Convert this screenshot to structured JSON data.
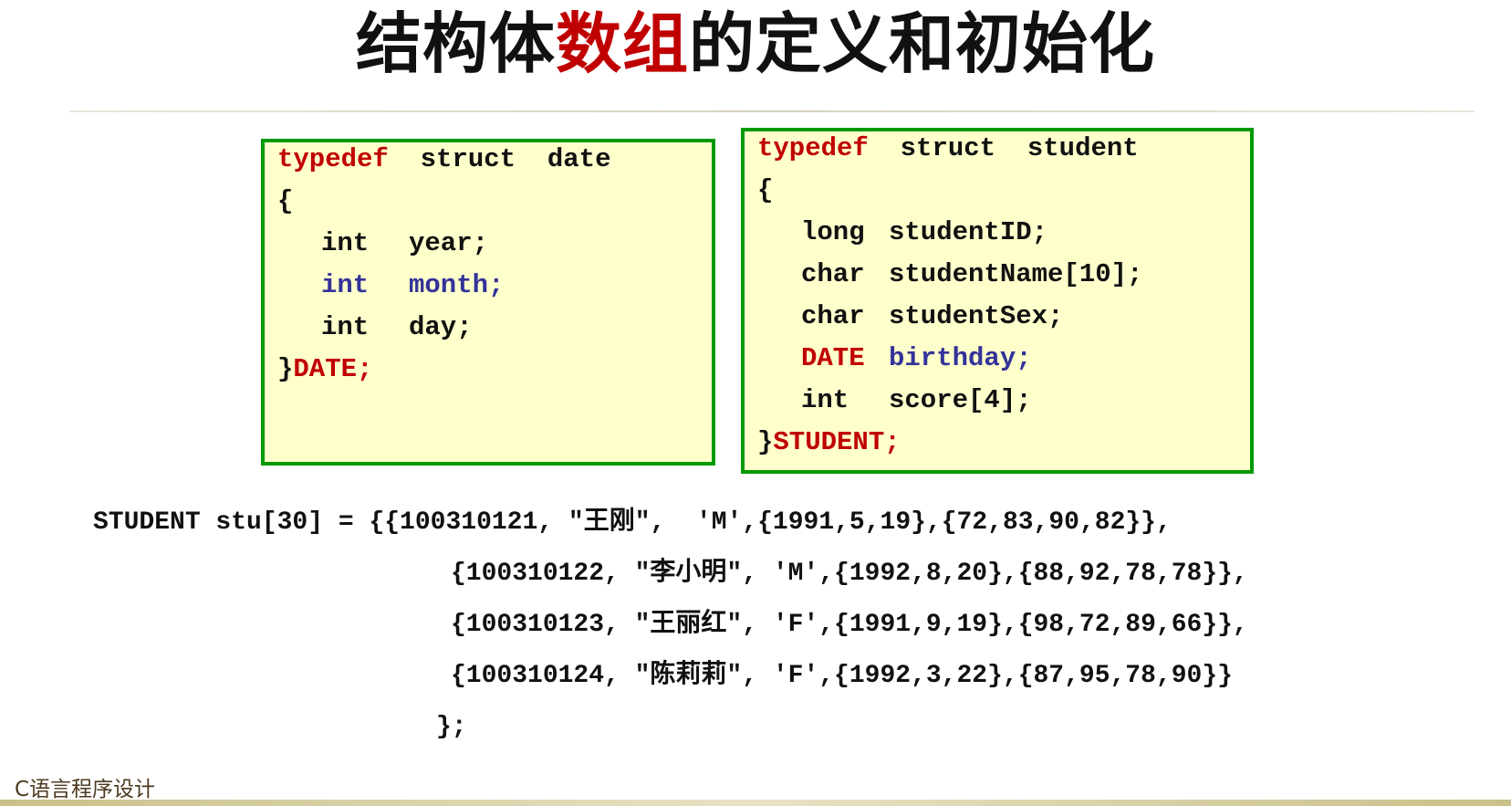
{
  "title": {
    "part1": "结构体",
    "part2": "数组",
    "part3": "的定义和初始化"
  },
  "colors": {
    "accent_red": "#c00000",
    "code_blue": "#333399",
    "box_bg": "#ffffcc",
    "box_border": "#009900"
  },
  "date_struct": {
    "kw": "typedef",
    "head": "  struct  date",
    "open": "{",
    "f1_type": "int",
    "f1_name": "year;",
    "f2_type": "int",
    "f2_name": "month;",
    "f3_type": "int",
    "f3_name": "day;",
    "close": "}",
    "alias": "DATE;"
  },
  "student_struct": {
    "kw": "typedef",
    "head": "  struct  student",
    "open": "{",
    "f1_type": "long",
    "f1_name": "studentID;",
    "f2_type": "char",
    "f2_name": "studentName[10];",
    "f3_type": "char",
    "f3_name": "studentSex;",
    "f4_type": "DATE",
    "f4_name": "birthday;",
    "f5_type": "int",
    "f5_name": "score[4];",
    "close": "}",
    "alias": "STUDENT;"
  },
  "init": {
    "line1": "STUDENT stu[30] = {{100310121, \"王刚\",  'M',{1991,5,19},{72,83,90,82}},",
    "line2": "{100310122, \"李小明\", 'M',{1992,8,20},{88,92,78,78}},",
    "line3": "{100310123, \"王丽红\", 'F',{1991,9,19},{98,72,89,66}},",
    "line4": "{100310124, \"陈莉莉\", 'F',{1992,3,22},{87,95,78,90}}",
    "line5": "};"
  },
  "footer": "C语言程序设计"
}
